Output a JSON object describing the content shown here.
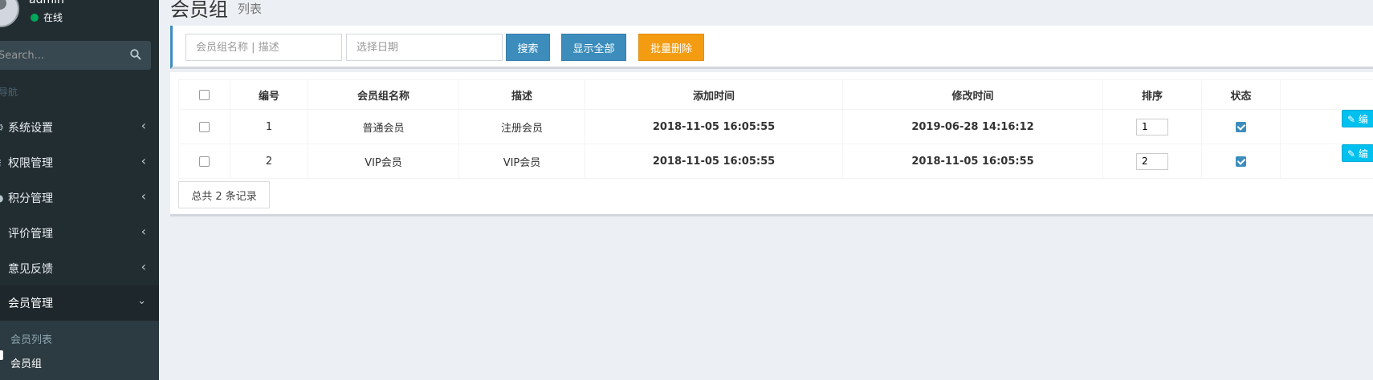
{
  "user": {
    "name": "admin",
    "status": "在线"
  },
  "sidebar": {
    "search_placeholder": "Search...",
    "nav_header": "导航",
    "items": [
      {
        "label": "系统设置"
      },
      {
        "label": "权限管理"
      },
      {
        "label": "积分管理"
      },
      {
        "label": "评价管理"
      },
      {
        "label": "意见反馈"
      },
      {
        "label": "会员管理"
      }
    ],
    "submenu": [
      {
        "label": "会员列表"
      },
      {
        "label": "会员组"
      }
    ]
  },
  "page": {
    "title": "会员组",
    "subtitle": "列表"
  },
  "toolbar": {
    "keyword_placeholder": "会员组名称 | 描述",
    "date_placeholder": "选择日期",
    "search_label": "搜索",
    "show_all_label": "显示全部",
    "batch_delete_label": "批量删除"
  },
  "table": {
    "headers": [
      "编号",
      "会员组名称",
      "描述",
      "添加时间",
      "修改时间",
      "排序",
      "状态",
      ""
    ],
    "rows": [
      {
        "id": "1",
        "name": "普通会员",
        "desc": "注册会员",
        "created": "2018-11-05 16:05:55",
        "modified": "2019-06-28 14:16:12",
        "sort": "1",
        "status": true,
        "action": "编辑"
      },
      {
        "id": "2",
        "name": "VIP会员",
        "desc": "VIP会员",
        "created": "2018-11-05 16:05:55",
        "modified": "2018-11-05 16:05:55",
        "sort": "2",
        "status": true,
        "action": "编辑"
      }
    ]
  },
  "footer": {
    "total": "总共 2 条记录"
  },
  "colors": {
    "sidebar": "#222d32",
    "primary": "#3c8dbc",
    "warning": "#f39c12",
    "info": "#00c0ef",
    "success": "#00a65a"
  }
}
